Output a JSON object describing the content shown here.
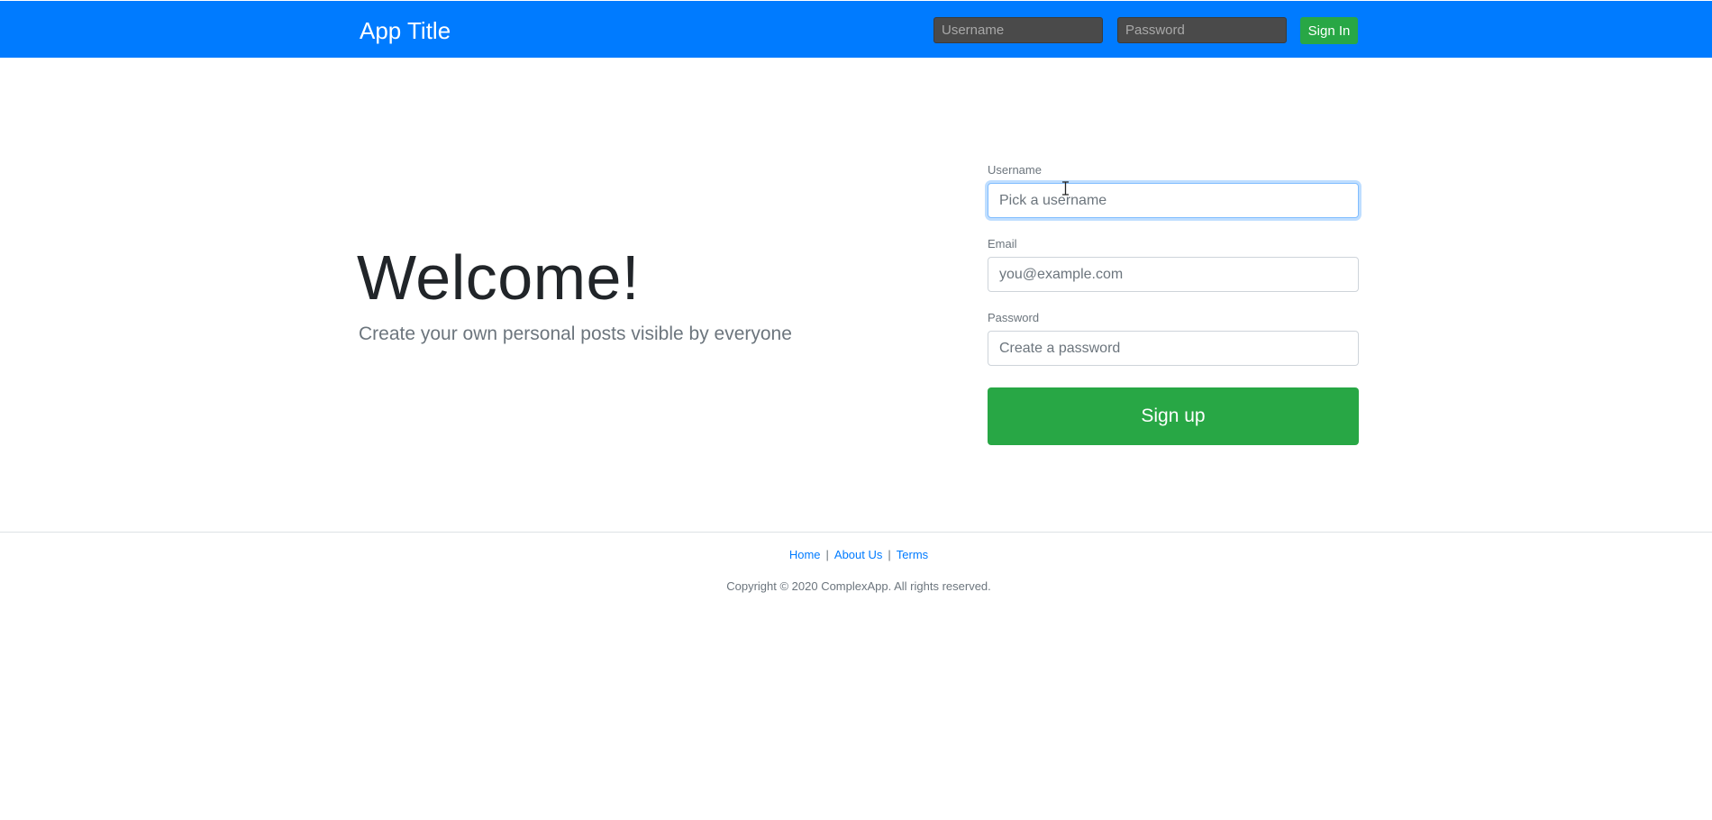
{
  "header": {
    "app_title": "App Title",
    "username_placeholder": "Username",
    "password_placeholder": "Password",
    "signin_label": "Sign In",
    "brand_color": "#007bff"
  },
  "hero": {
    "heading": "Welcome!",
    "lead": "Create your own personal posts visible by everyone"
  },
  "signup_form": {
    "username_label": "Username",
    "username_placeholder": "Pick a username",
    "email_label": "Email",
    "email_placeholder": "you@example.com",
    "password_label": "Password",
    "password_placeholder": "Create a password",
    "submit_label": "Sign up",
    "submit_color": "#28a745",
    "focused_field": "username"
  },
  "footer": {
    "links": [
      {
        "label": "Home"
      },
      {
        "label": "About Us"
      },
      {
        "label": "Terms"
      }
    ],
    "separator": "|",
    "copyright": "Copyright © 2020 ComplexApp. All rights reserved."
  },
  "cursor": {
    "icon": "text-cursor-icon"
  }
}
